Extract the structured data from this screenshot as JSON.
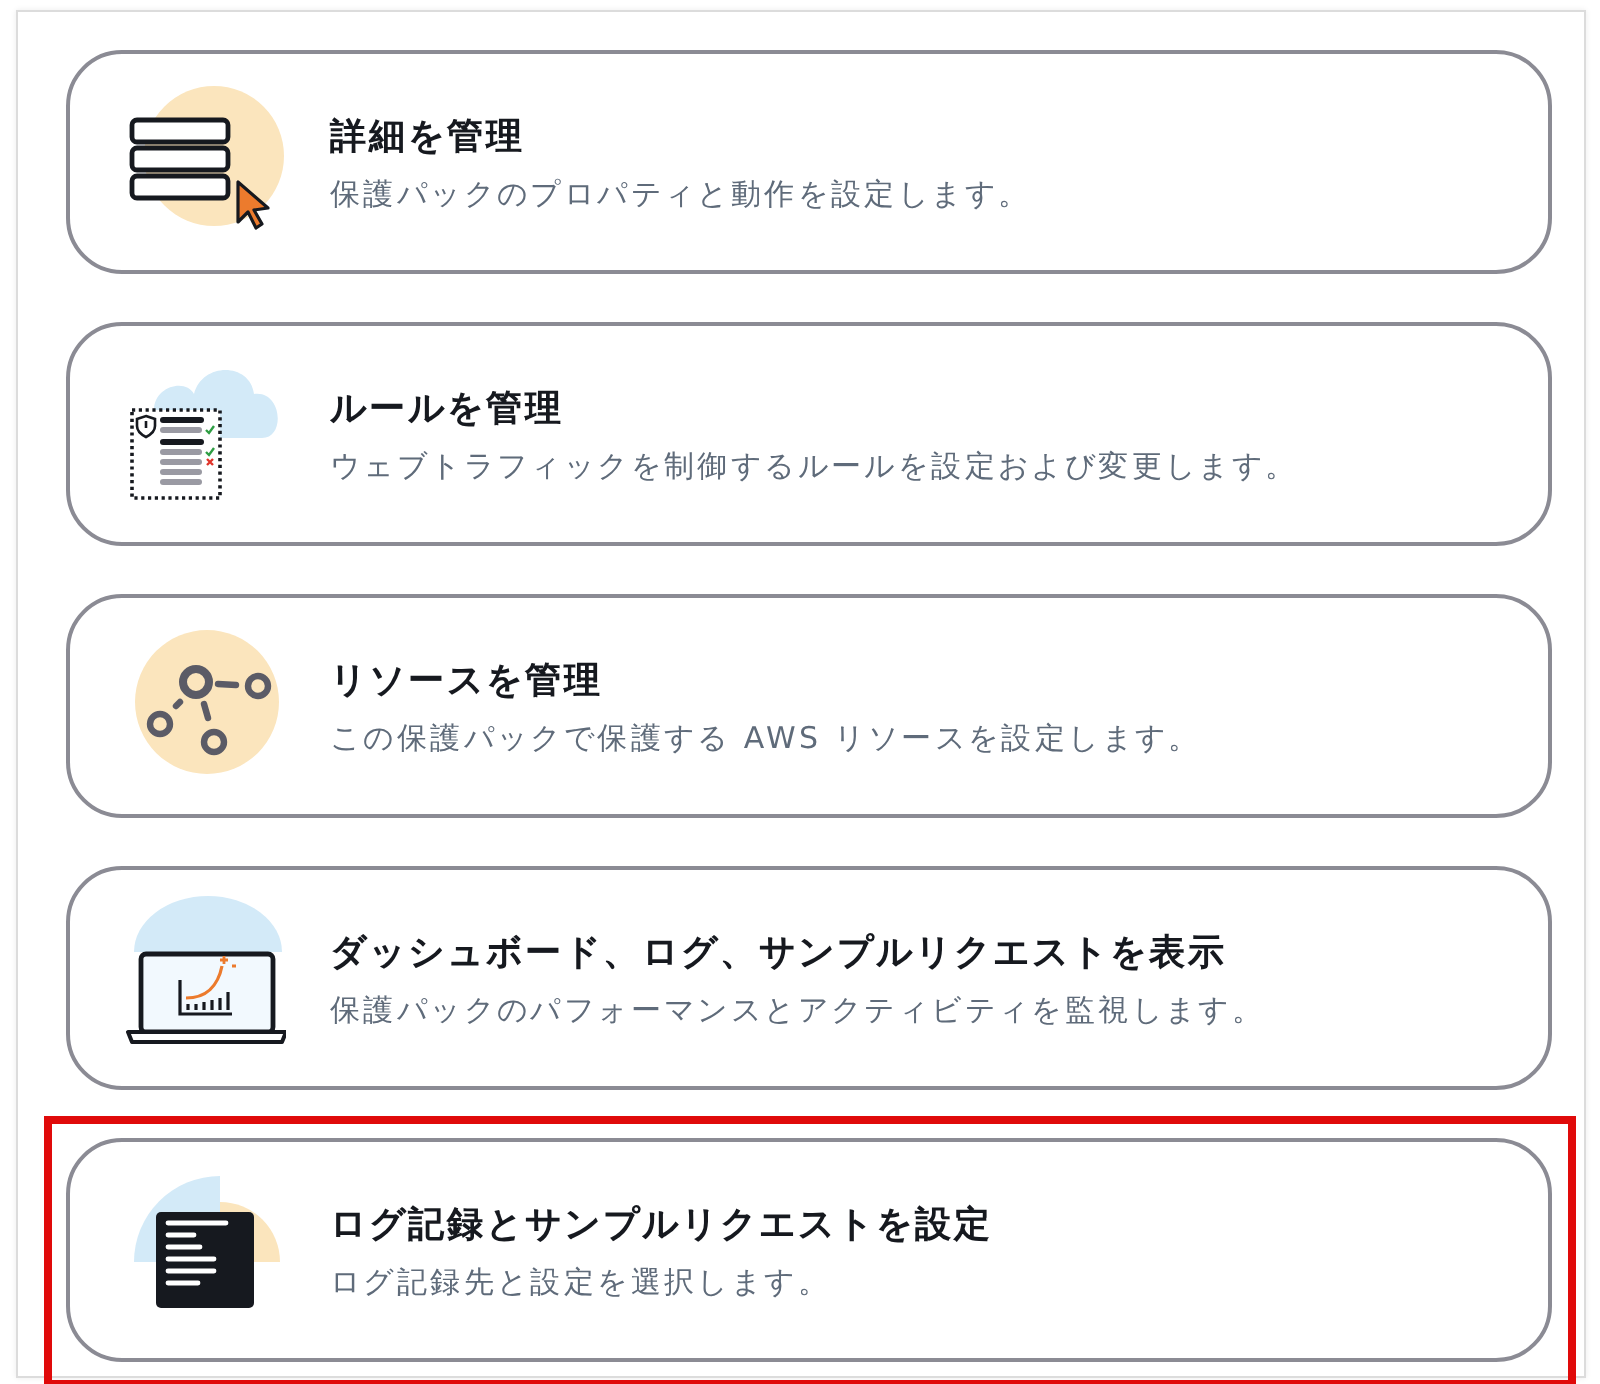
{
  "cards": [
    {
      "kind": "details",
      "title": "詳細を管理",
      "description": "保護パックのプロパティと動作を設定します。",
      "highlighted": false
    },
    {
      "kind": "rules",
      "title": "ルールを管理",
      "description": "ウェブトラフィックを制御するルールを設定および変更します。",
      "highlighted": false
    },
    {
      "kind": "resources",
      "title": "リソースを管理",
      "description": "この保護パックで保護する AWS リソースを設定します。",
      "highlighted": false
    },
    {
      "kind": "dashboard",
      "title": "ダッシュボード、ログ、サンプルリクエストを表示",
      "description": "保護パックのパフォーマンスとアクティビティを監視します。",
      "highlighted": false
    },
    {
      "kind": "logging",
      "title": "ログ記録とサンプルリクエストを設定",
      "description": "ログ記録先と設定を選択します。",
      "highlighted": true
    }
  ]
}
